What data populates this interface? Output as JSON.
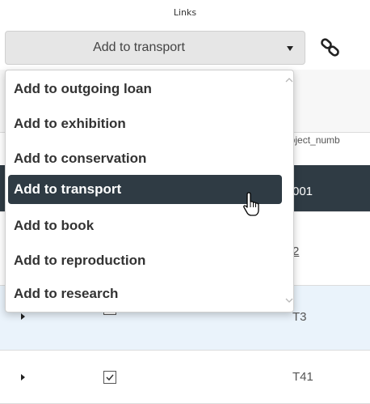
{
  "header": {
    "title": "Links"
  },
  "select": {
    "value": "Add to transport",
    "caret_icon": "caret-down-icon",
    "link_icon": "link-chain-icon"
  },
  "dropdown": {
    "items": [
      {
        "label": "Add to outgoing loan",
        "selected": false
      },
      {
        "label": "Add to exhibition",
        "selected": false
      },
      {
        "label": "Add to conservation",
        "selected": false
      },
      {
        "label": "Add to transport",
        "selected": true
      },
      {
        "label": "Add to book",
        "selected": false
      },
      {
        "label": "Add to reproduction",
        "selected": false
      },
      {
        "label": "Add to research",
        "selected": false
      }
    ],
    "selected_color": "#2f3b44"
  },
  "table": {
    "column_header": "object_numb",
    "rows": [
      {
        "value": "001"
      },
      {
        "value": "2"
      },
      {
        "value": "T3"
      },
      {
        "value": "T41",
        "checked": true
      }
    ]
  },
  "colors": {
    "dark_row": "#2f3b44",
    "light_row": "#eaf3fb"
  }
}
